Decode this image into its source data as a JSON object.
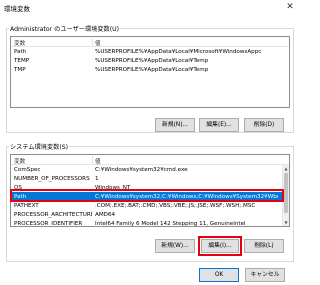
{
  "window": {
    "title": "環境変数"
  },
  "user_vars": {
    "group_label": "Administrator のユーザー環境変数(U)",
    "col_name": "変数",
    "col_value": "値",
    "rows": [
      {
        "name": "Path",
        "value": "%USERPROFILE%¥AppData¥Local¥Microsoft¥WindowsAppс"
      },
      {
        "name": "TEMP",
        "value": "%USERPROFILE%¥AppData¥Local¥Temp"
      },
      {
        "name": "TMP",
        "value": "%USERPROFILE%¥AppData¥Local¥Temp"
      }
    ],
    "buttons": {
      "new": "新規(N)...",
      "edit": "編集(E)...",
      "delete": "削除(D)"
    }
  },
  "system_vars": {
    "group_label": "システム環境変数(S)",
    "col_name": "変数",
    "col_value": "値",
    "rows": [
      {
        "name": "ComSpec",
        "value": "C:¥Windows¥system32¥cmd.exe"
      },
      {
        "name": "NUMBER_OF_PROCESSORS",
        "value": "1"
      },
      {
        "name": "OS",
        "value": "Windows_NT"
      },
      {
        "name": "Path",
        "value": "C:¥Windows¥system32;C:¥Windows;C:¥Windows¥System32¥Wbem;...",
        "selected": true
      },
      {
        "name": "PATHEXT",
        "value": ".COM;.EXE;.BAT;.CMD;.VBS;.VBE;.JS;.JSE;.WSF;.WSH;.MSC"
      },
      {
        "name": "PROCESSOR_ARCHITECTURE",
        "value": "AMD64"
      },
      {
        "name": "PROCESSOR_IDENTIFIER",
        "value": "Intel64 Family 6 Model 142 Stepping 11, GenuineIntel"
      }
    ],
    "buttons": {
      "new": "新規(W)...",
      "edit": "編集(I)...",
      "delete": "削除(L)"
    }
  },
  "footer": {
    "ok": "OK",
    "cancel": "キャンセル"
  },
  "colors": {
    "selection": "#0078d7",
    "highlight": "#e60012"
  }
}
